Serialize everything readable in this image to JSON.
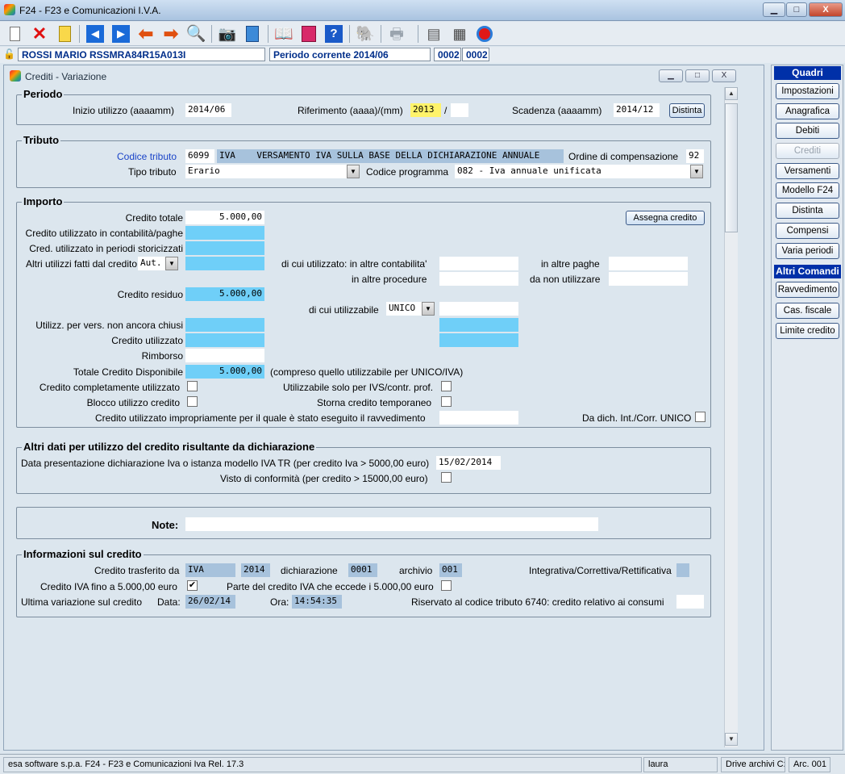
{
  "window": {
    "title": "F24 - F23 e Comunicazioni I.V.A.",
    "min": "▁",
    "max": "□",
    "close": "X"
  },
  "toolbar": {
    "icons": [
      "new-icon",
      "delete-icon",
      "document-icon",
      "first-icon",
      "next-icon",
      "undo-icon",
      "redo-icon",
      "search-icon",
      "camera-icon",
      "calculator-icon",
      "book-icon",
      "pink-book-icon",
      "help-icon",
      "elephant-icon",
      "printer-icon",
      "scanner-icon",
      "calendar-icon",
      "exit-icon"
    ]
  },
  "infobar": {
    "user": "ROSSI MARIO RSSMRA84R15A013I",
    "period": "Periodo corrente 2014/06",
    "code1": "0002",
    "code2": "0002"
  },
  "child": {
    "title": "Crediti - Variazione"
  },
  "periodo": {
    "legend": "Periodo",
    "inizio_label": "Inizio utilizzo (aaaamm)",
    "inizio": "2014/06",
    "rif_label": "Riferimento (aaaa)/(mm)",
    "rif_year": "2013",
    "slash": "/",
    "rif_month": "",
    "scad_label": "Scadenza (aaaamm)",
    "scad": "2014/12",
    "distinta_btn": "Distinta"
  },
  "tributo": {
    "legend": "Tributo",
    "codice_label": "Codice tributo",
    "codice": "6099",
    "codice_desc": "IVA    VERSAMENTO IVA SULLA BASE DELLA DICHIARAZIONE ANNUALE",
    "ordine_label": "Ordine di compensazione",
    "ordine": "92",
    "tipo_label": "Tipo tributo",
    "tipo": "Erario",
    "prog_label": "Codice programma",
    "prog": "082 - Iva annuale unificata"
  },
  "importo": {
    "legend": "Importo",
    "credito_totale_label": "Credito totale",
    "credito_totale": "5.000,00",
    "assegna_btn": "Assegna credito",
    "contab_label": "Credito utilizzato in contabilità/paghe",
    "contab": "",
    "storic_label": "Cred. utilizzato in periodi storicizzati",
    "storic": "",
    "altri_label": "Altri utilizzi fatti dal credito",
    "altri_sel": "Aut.",
    "altri": "",
    "di_cui_label": "di cui utilizzato: in altre contabilita'",
    "altre_contab": "",
    "altre_paghe_label": "in altre paghe",
    "altre_paghe": "",
    "altre_proc_label": "in altre procedure",
    "altre_proc": "",
    "non_util_label": "da non utilizzare",
    "non_util": "",
    "residuo_label": "Credito residuo",
    "residuo": "5.000,00",
    "di_cui_util_label": "di cui utilizzabile",
    "di_cui_util_sel": "UNICO",
    "di_cui_util": "",
    "vers_label": "Utilizz. per vers. non ancora chiusi",
    "vers": "",
    "vers_r": "",
    "cred_util_label": "Credito utilizzato",
    "cred_util": "",
    "cred_util_r": "",
    "rimborso_label": "Rimborso",
    "rimborso": "",
    "tot_disp_label": "Totale Credito Disponibile",
    "tot_disp": "5.000,00",
    "tot_disp_note": "(compreso quello utilizzabile per UNICO/IVA)",
    "compl_label": "Credito completamente utilizzato",
    "compl": "",
    "ivs_label": "Utilizzabile solo per IVS/contr. prof.",
    "ivs": "",
    "blocco_label": "Blocco utilizzo credito",
    "blocco": "",
    "storna_label": "Storna credito temporaneo",
    "storna": "",
    "impropr_label": "Credito utilizzato impropriamente per il quale è stato eseguito il ravvedimento",
    "impropr": "",
    "dich_label": "Da dich. Int./Corr. UNICO",
    "dich": ""
  },
  "altri_dati": {
    "legend": "Altri dati per utilizzo del credito risultante da dichiarazione",
    "data_label": "Data presentazione dichiarazione Iva o istanza modello IVA TR (per credito Iva > 5000,00 euro)",
    "data": "15/02/2014",
    "visto_label": "Visto di conformità (per credito > 15000,00 euro)",
    "visto": ""
  },
  "note": {
    "label": "Note:",
    "value": ""
  },
  "info": {
    "legend": "Informazioni sul credito",
    "trasf_label": "Credito trasferito da",
    "trasf": "IVA",
    "anno": "2014",
    "dich_label": "dichiarazione",
    "dich": "0001",
    "arch_label": "archivio",
    "arch": "001",
    "integr_label": "Integrativa/Correttiva/Rettificativa",
    "integr": "",
    "fino_label": "Credito IVA fino a 5.000,00 euro",
    "fino": "✔",
    "eccede_label": "Parte del credito IVA che eccede i 5.000,00 euro",
    "eccede": "",
    "ultima_label": "Ultima variazione sul credito",
    "data_label": "Data:",
    "data": "26/02/14",
    "ora_label": "Ora:",
    "ora": "14:54:35",
    "ris_label": "Riservato al codice tributo 6740: credito relativo ai consumi",
    "ris": ""
  },
  "side": {
    "quadri": "Quadri",
    "impostazioni": "Impostazioni",
    "anagrafica": "Anagrafica",
    "debiti": "Debiti",
    "crediti": "Crediti",
    "versamenti": "Versamenti",
    "modello": "Modello F24",
    "distinta": "Distinta",
    "compensi": "Compensi",
    "varia": "Varia periodi",
    "altri": "Altri Comandi",
    "ravv": "Ravvedimento",
    "cas": "Cas. fiscale",
    "limite": "Limite credito"
  },
  "status": {
    "company": "esa software s.p.a.  F24 - F23 e Comunicazioni Iva  Rel. 17.3",
    "user": "laura",
    "drive": "Drive archivi C:",
    "arc": "Arc. 001"
  }
}
